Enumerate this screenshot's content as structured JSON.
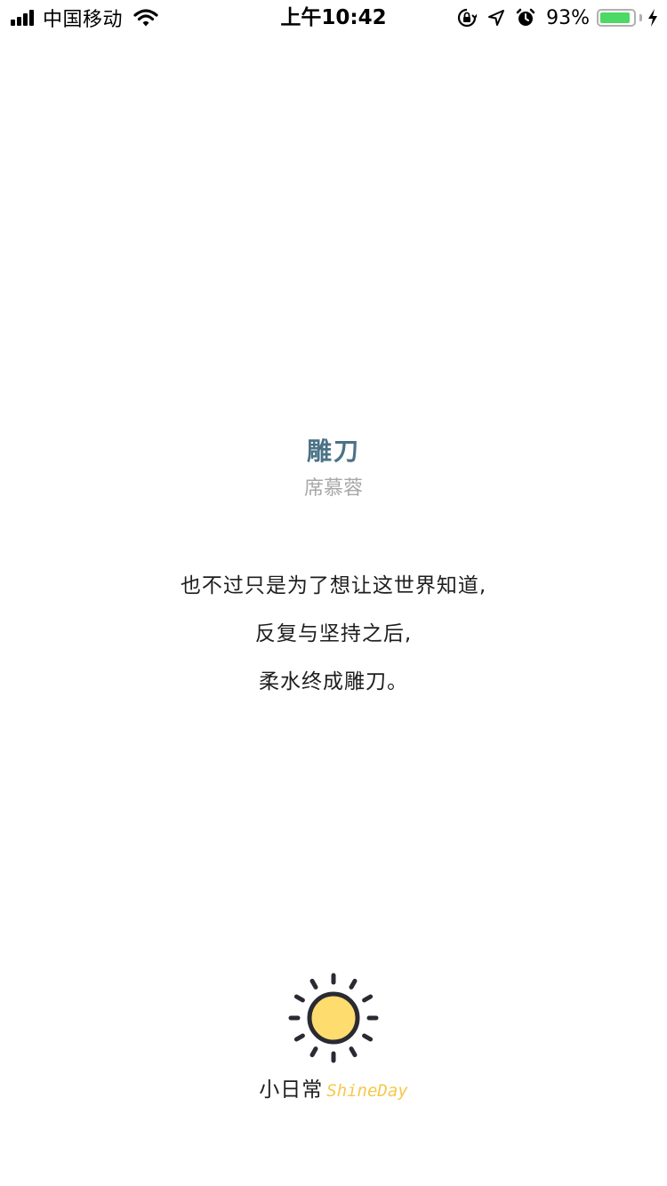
{
  "status_bar": {
    "carrier": "中国移动",
    "time": "上午10:42",
    "battery_percent": "93%",
    "battery_level": 0.93,
    "icons": [
      "signal-icon",
      "wifi-icon",
      "orientation-lock-icon",
      "location-icon",
      "alarm-icon",
      "battery-icon",
      "charging-icon"
    ]
  },
  "poem": {
    "title": "雕刀",
    "author": "席慕蓉",
    "lines": [
      "也不过只是为了想让这世界知道,",
      "反复与坚持之后,",
      "柔水终成雕刀。"
    ]
  },
  "brand": {
    "name_cn": "小日常",
    "name_en": "ShineDay",
    "logo_icon": "sun-icon"
  },
  "colors": {
    "title": "#4b7286",
    "author": "#a8a8a8",
    "sun_fill": "#ffdc6e",
    "brand_en": "#f6c84a",
    "battery": "#4cd964"
  }
}
